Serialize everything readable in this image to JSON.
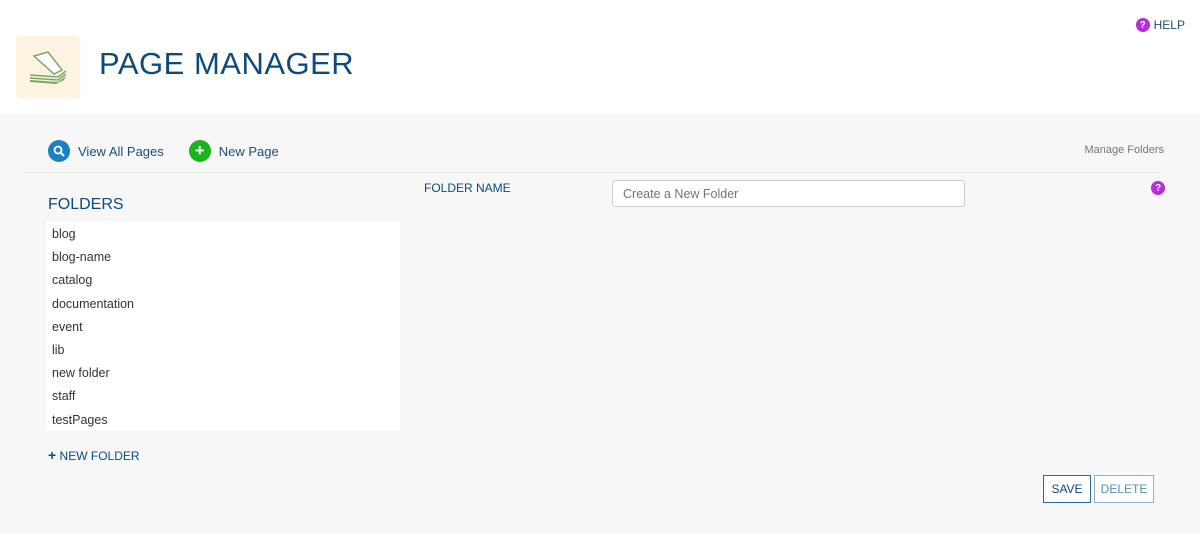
{
  "header": {
    "help_label": "HELP",
    "title": "PAGE MANAGER"
  },
  "toolbar": {
    "view_all": "View All Pages",
    "new_page": "New Page",
    "manage_folders": "Manage Folders"
  },
  "folders": {
    "heading": "FOLDERS",
    "items": [
      "blog",
      "blog-name",
      "catalog",
      "documentation",
      "event",
      "lib",
      "new folder",
      "staff",
      "testPages"
    ],
    "new_folder": "NEW FOLDER"
  },
  "form": {
    "label": "FOLDER NAME",
    "placeholder": "Create a New Folder",
    "save": "SAVE",
    "delete": "DELETE"
  },
  "colors": {
    "accent": "#0d4a7e",
    "help": "#b52ed6",
    "search": "#1a82c4",
    "add": "#1db31d"
  }
}
